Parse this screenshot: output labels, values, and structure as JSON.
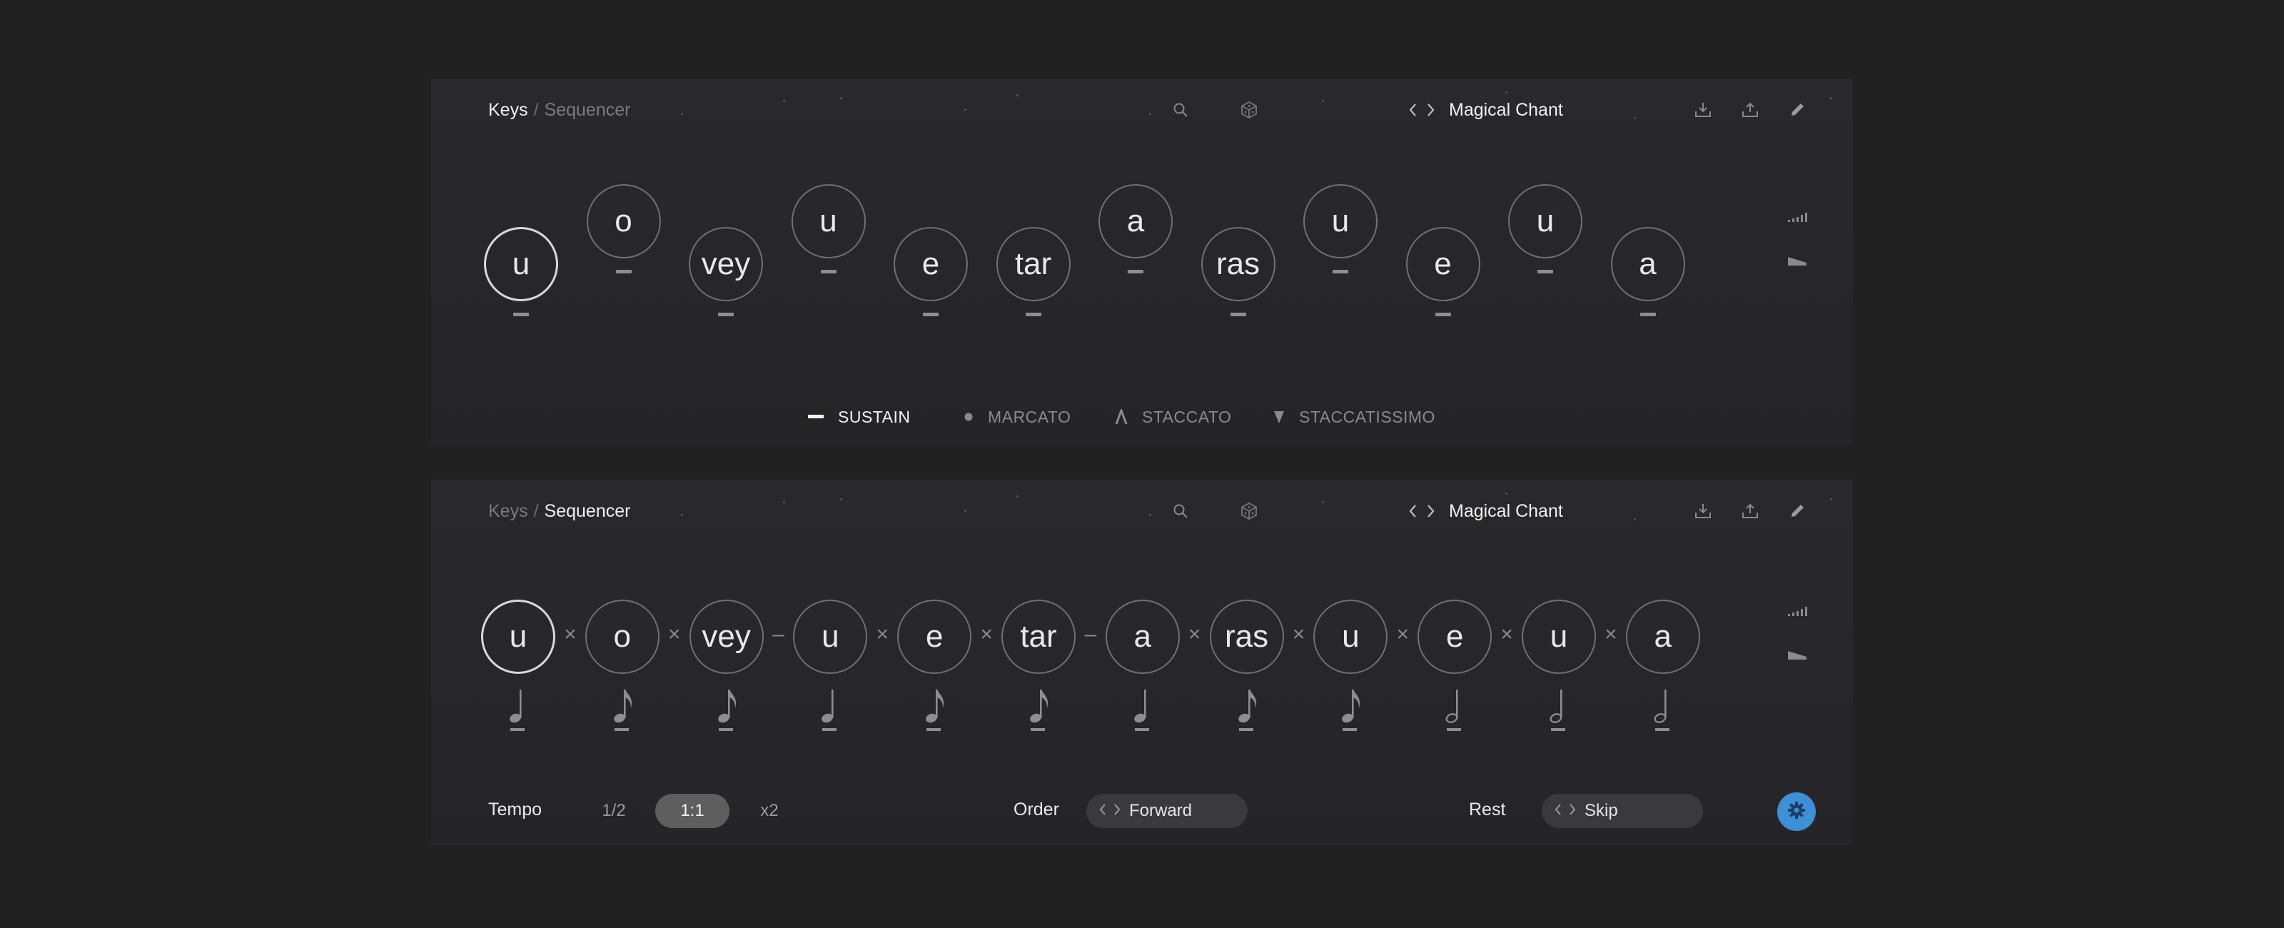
{
  "colors": {
    "background": "#212121",
    "panel": "#28282a",
    "accent": "#3d8fd6",
    "ring": "#707070",
    "ring_selected": "#d8d8d8"
  },
  "keys_panel": {
    "breadcrumb": {
      "first": "Keys",
      "separator": "/",
      "second": "Sequencer",
      "active": "Keys"
    },
    "preset_name": "Magical Chant",
    "icons": [
      "chevron-left-icon",
      "chevron-right-icon",
      "search-icon",
      "dice-icon",
      "download-icon",
      "upload-icon",
      "pencil-icon",
      "velocity-icon",
      "ramp-icon"
    ],
    "syllables": [
      {
        "text": "u",
        "level": "low",
        "selected": true
      },
      {
        "text": "o",
        "level": "high"
      },
      {
        "text": "vey",
        "level": "low"
      },
      {
        "text": "u",
        "level": "high"
      },
      {
        "text": "e",
        "level": "low"
      },
      {
        "text": "tar",
        "level": "low"
      },
      {
        "text": "a",
        "level": "high"
      },
      {
        "text": "ras",
        "level": "low"
      },
      {
        "text": "u",
        "level": "high"
      },
      {
        "text": "e",
        "level": "low"
      },
      {
        "text": "u",
        "level": "high"
      },
      {
        "text": "a",
        "level": "low"
      }
    ],
    "articulations": [
      {
        "label": "SUSTAIN",
        "icon": "sustain-icon",
        "active": true
      },
      {
        "label": "MARCATO",
        "icon": "marcato-icon",
        "active": false
      },
      {
        "label": "STACCATO",
        "icon": "staccato-icon",
        "active": false
      },
      {
        "label": "STACCATISSIMO",
        "icon": "staccatissimo-icon",
        "active": false
      }
    ]
  },
  "sequencer_panel": {
    "breadcrumb": {
      "first": "Keys",
      "separator": "/",
      "second": "Sequencer",
      "active": "Sequencer"
    },
    "preset_name": "Magical Chant",
    "steps": [
      {
        "text": "u",
        "duration": "quarter",
        "selected": true
      },
      {
        "text": "o",
        "duration": "eighth"
      },
      {
        "text": "vey",
        "duration": "eighth"
      },
      {
        "text": "u",
        "duration": "quarter"
      },
      {
        "text": "e",
        "duration": "eighth"
      },
      {
        "text": "tar",
        "duration": "eighth"
      },
      {
        "text": "a",
        "duration": "quarter"
      },
      {
        "text": "ras",
        "duration": "eighth"
      },
      {
        "text": "u",
        "duration": "eighth"
      },
      {
        "text": "e",
        "duration": "half"
      },
      {
        "text": "u",
        "duration": "half"
      },
      {
        "text": "a",
        "duration": "half"
      }
    ],
    "links": [
      "×",
      "×",
      "–",
      "×",
      "×",
      "–",
      "×",
      "×",
      "×",
      "×",
      "×"
    ],
    "tempo": {
      "label": "Tempo",
      "options": [
        "1/2",
        "1:1",
        "x2"
      ],
      "selected": "1:1"
    },
    "order": {
      "label": "Order",
      "value": "Forward"
    },
    "rest": {
      "label": "Rest",
      "value": "Skip"
    },
    "settings_icon": "gear-icon"
  }
}
